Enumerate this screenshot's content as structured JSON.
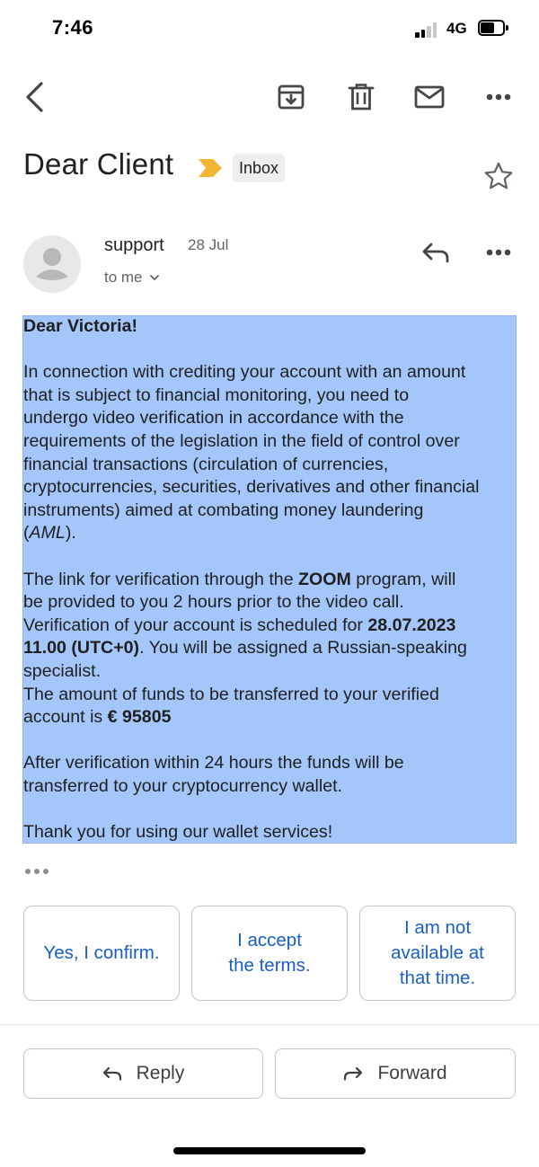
{
  "status_bar": {
    "time": "7:46",
    "network": "4G"
  },
  "toolbar": {
    "icons": [
      "back-arrow-icon",
      "archive-icon",
      "delete-icon",
      "mark-unread-icon",
      "more-options-icon"
    ]
  },
  "email": {
    "subject": "Dear Client",
    "label": "Inbox",
    "sender": "support",
    "date": "28 Jul",
    "recipient": "to me",
    "body": {
      "greeting": "Dear Victoria!",
      "p1_lines": [
        "In connection with crediting your account with an amount",
        "that is subject to financial monitoring, you need to",
        "undergo video verification in accordance with the",
        "requirements of the legislation in the field of control over",
        "financial transactions (circulation of currencies,",
        "cryptocurrencies, securities, derivatives and other financial",
        "instruments) aimed at combating money laundering"
      ],
      "p1_end_open": "(",
      "p1_end_italic": "AML",
      "p1_end_close": ").",
      "p2_a": "The link for verification through the ",
      "p2_zoom": "ZOOM",
      "p2_b": " program, will",
      "p2_line2": "be provided to you 2 hours prior to the video call.",
      "p2_line3_a": "Verification of your account is scheduled for ",
      "p2_date": "28.07.2023",
      "p2_time": "11.00 (UTC+0)",
      "p2_line4_b": ". You will be assigned a Russian-speaking",
      "p2_line5": "specialist.",
      "p3_line1": "The amount of funds to be transferred to your verified",
      "p3_line2_a": "account is ",
      "p3_amount": "€ 95805",
      "p4_line1": "After verification within 24 hours the funds will be",
      "p4_line2": "transferred to your cryptocurrency wallet.",
      "p5": "Thank you for using our wallet services!"
    }
  },
  "smart_replies": [
    {
      "lines": [
        "Yes, I confirm."
      ]
    },
    {
      "lines": [
        "I accept",
        "the terms."
      ]
    },
    {
      "lines": [
        "I am not",
        "available at",
        "that time."
      ]
    }
  ],
  "actions": {
    "reply": "Reply",
    "forward": "Forward"
  },
  "colors": {
    "highlight": "#a4c6fa",
    "link_blue": "#1a5ec2",
    "importance": "#f2b632"
  }
}
